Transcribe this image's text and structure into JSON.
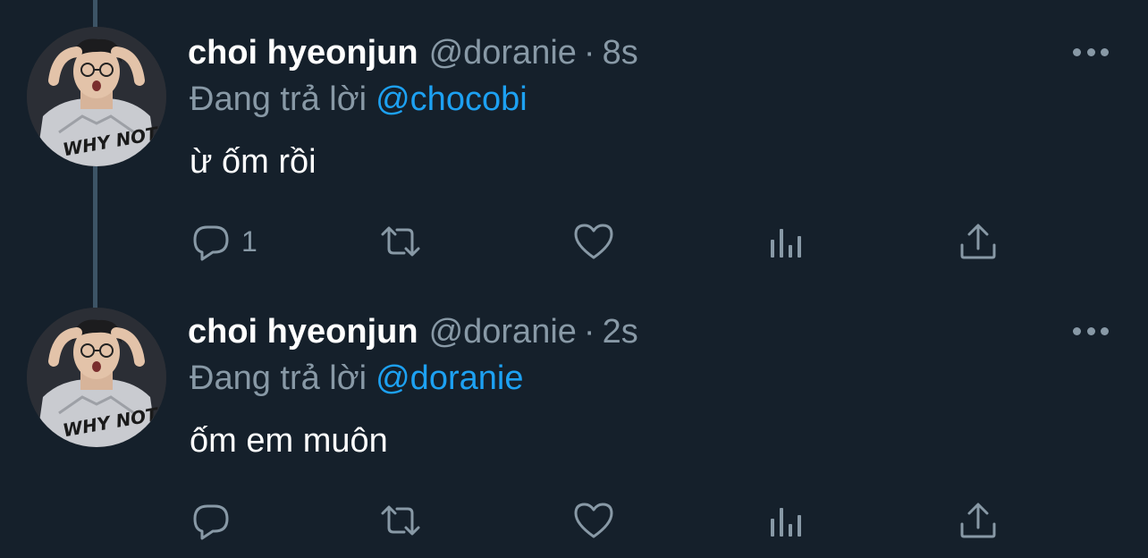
{
  "tweets": [
    {
      "name": "choi hyeonjun",
      "handle": "@doranie",
      "separator": "·",
      "time": "8s",
      "reply_prefix": "Đang trả lời",
      "reply_to": "@chocobi",
      "text": "ừ ốm rồi",
      "reply_count": "1"
    },
    {
      "name": "choi hyeonjun",
      "handle": "@doranie",
      "separator": "·",
      "time": "2s",
      "reply_prefix": "Đang trả lời",
      "reply_to": "@doranie",
      "text": "ốm em muôn",
      "reply_count": ""
    }
  ],
  "avatar_text": "WHY NOT?!",
  "colors": {
    "background": "#15202b",
    "secondary_text": "#8899a6",
    "link": "#1da1f2",
    "thread_line": "#3d5466"
  }
}
